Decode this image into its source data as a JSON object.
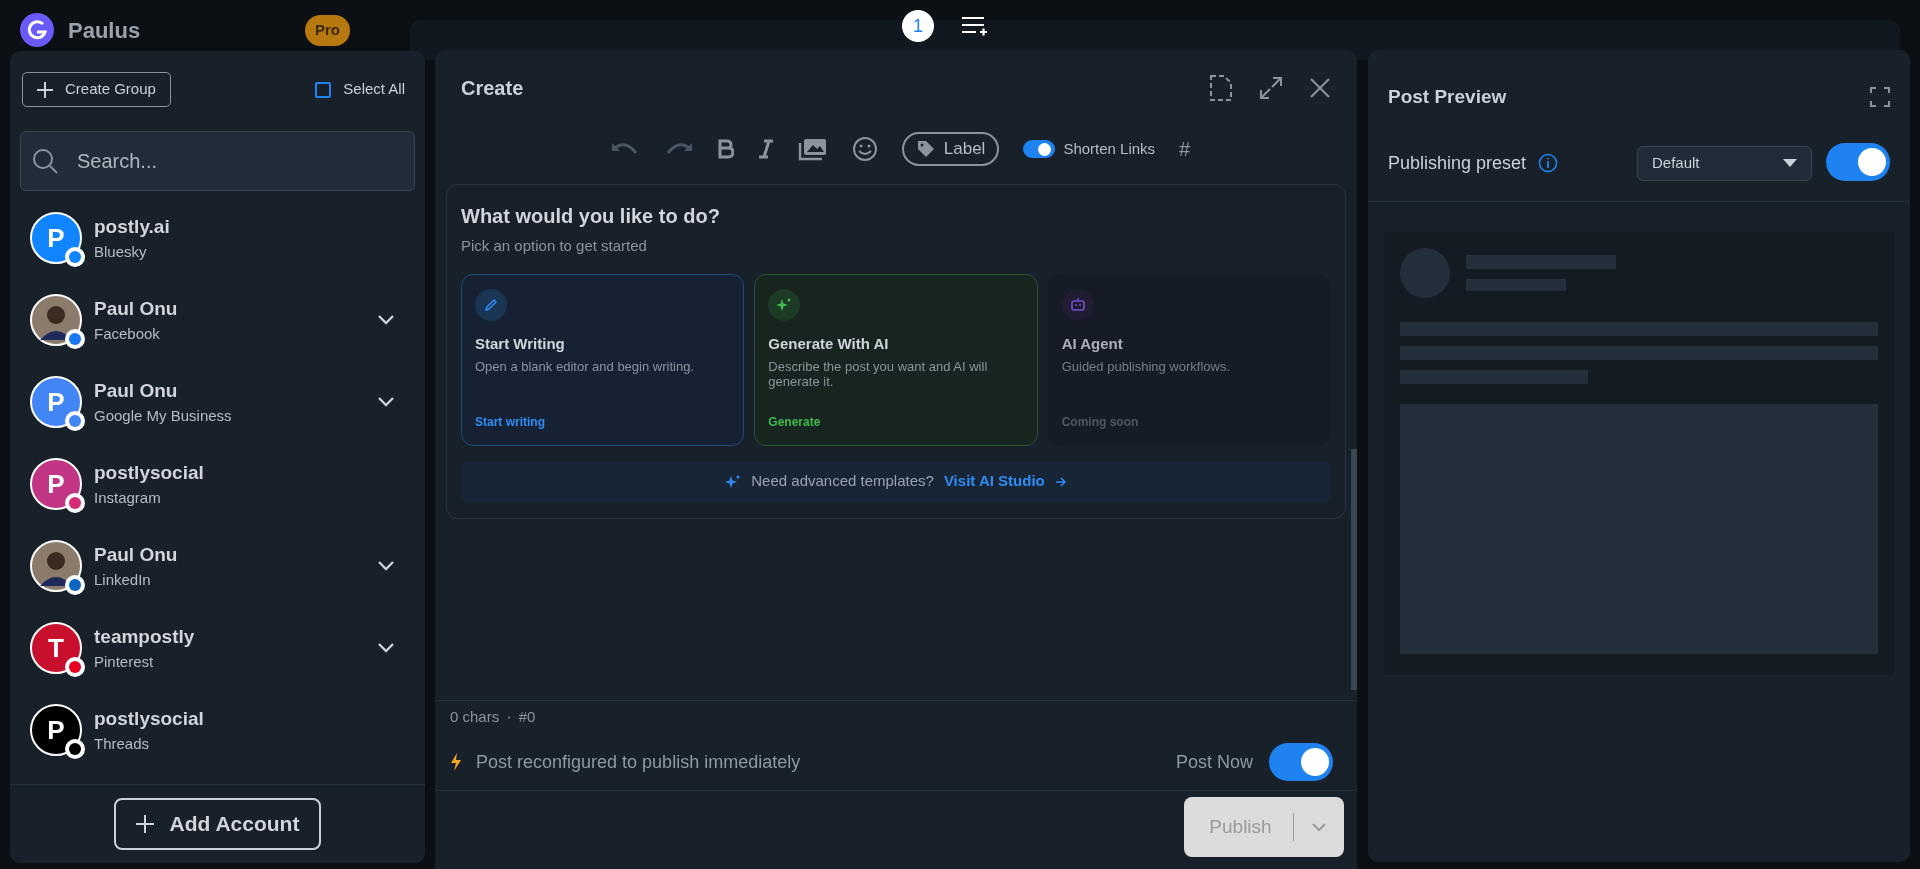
{
  "background_header": {
    "workspace": "Paulus",
    "plan_badge": "Pro"
  },
  "top_bar": {
    "queue_count": "1"
  },
  "accounts_panel": {
    "create_group": "Create Group",
    "select_all": {
      "label": "Select All",
      "checked": false
    },
    "search": {
      "placeholder": "Search..."
    },
    "accounts": [
      {
        "name": "postly.ai",
        "platform": "Bluesky",
        "avatar": {
          "kind": "letter",
          "letter": "P",
          "color": "#1185fe"
        },
        "kind": "bluesky",
        "expandable": false
      },
      {
        "name": "Paul Onu",
        "platform": "Facebook",
        "avatar": {
          "kind": "photo"
        },
        "kind": "facebook",
        "expandable": true
      },
      {
        "name": "Paul Onu",
        "platform": "Google My Business",
        "avatar": {
          "kind": "letter",
          "letter": "P",
          "color": "#4285f4"
        },
        "kind": "google",
        "expandable": true
      },
      {
        "name": "postlysocial",
        "platform": "Instagram",
        "avatar": {
          "kind": "letter",
          "letter": "P",
          "color": "#c13584"
        },
        "kind": "instagram",
        "expandable": false
      },
      {
        "name": "Paul Onu",
        "platform": "LinkedIn",
        "avatar": {
          "kind": "photo"
        },
        "kind": "linkedin",
        "expandable": true
      },
      {
        "name": "teampostly",
        "platform": "Pinterest",
        "avatar": {
          "kind": "letter",
          "letter": "T",
          "color": "#c8102e"
        },
        "kind": "pinterest",
        "expandable": true
      },
      {
        "name": "postlysocial",
        "platform": "Threads",
        "avatar": {
          "kind": "letter",
          "letter": "P",
          "color": "#000000"
        },
        "kind": "threads",
        "expandable": false
      }
    ],
    "add_account": "Add Account"
  },
  "editor": {
    "title": "Create",
    "toolbar": {
      "label_button": "Label",
      "shorten_links": {
        "label": "Shorten Links",
        "on": true
      },
      "hashtag": "#"
    },
    "prompt": {
      "heading": "What would you like to do?",
      "subheading": "Pick an option to get started",
      "options": [
        {
          "title": "Start Writing",
          "description": "Open a blank editor and begin writing.",
          "action": "Start writing",
          "kind": "write",
          "disabled": false
        },
        {
          "title": "Generate With AI",
          "description": "Describe the post you want and AI will generate it.",
          "action": "Generate",
          "kind": "ai",
          "disabled": false
        },
        {
          "title": "AI Agent",
          "description": "Guided publishing workflows.",
          "action": "Coming soon",
          "kind": "agent",
          "disabled": true
        }
      ],
      "templates_text": "Need advanced templates?",
      "templates_link": "Visit AI Studio"
    },
    "char_count": "0 chars",
    "separator": "•",
    "post_number": "#0",
    "notice": "Post reconfigured to publish immediately",
    "post_now": {
      "label": "Post Now",
      "on": true
    },
    "publish": {
      "label": "Publish",
      "disabled": true
    }
  },
  "preview": {
    "title": "Post Preview",
    "preset_label": "Publishing preset",
    "preset_value": "Default",
    "preset_on": true
  }
}
